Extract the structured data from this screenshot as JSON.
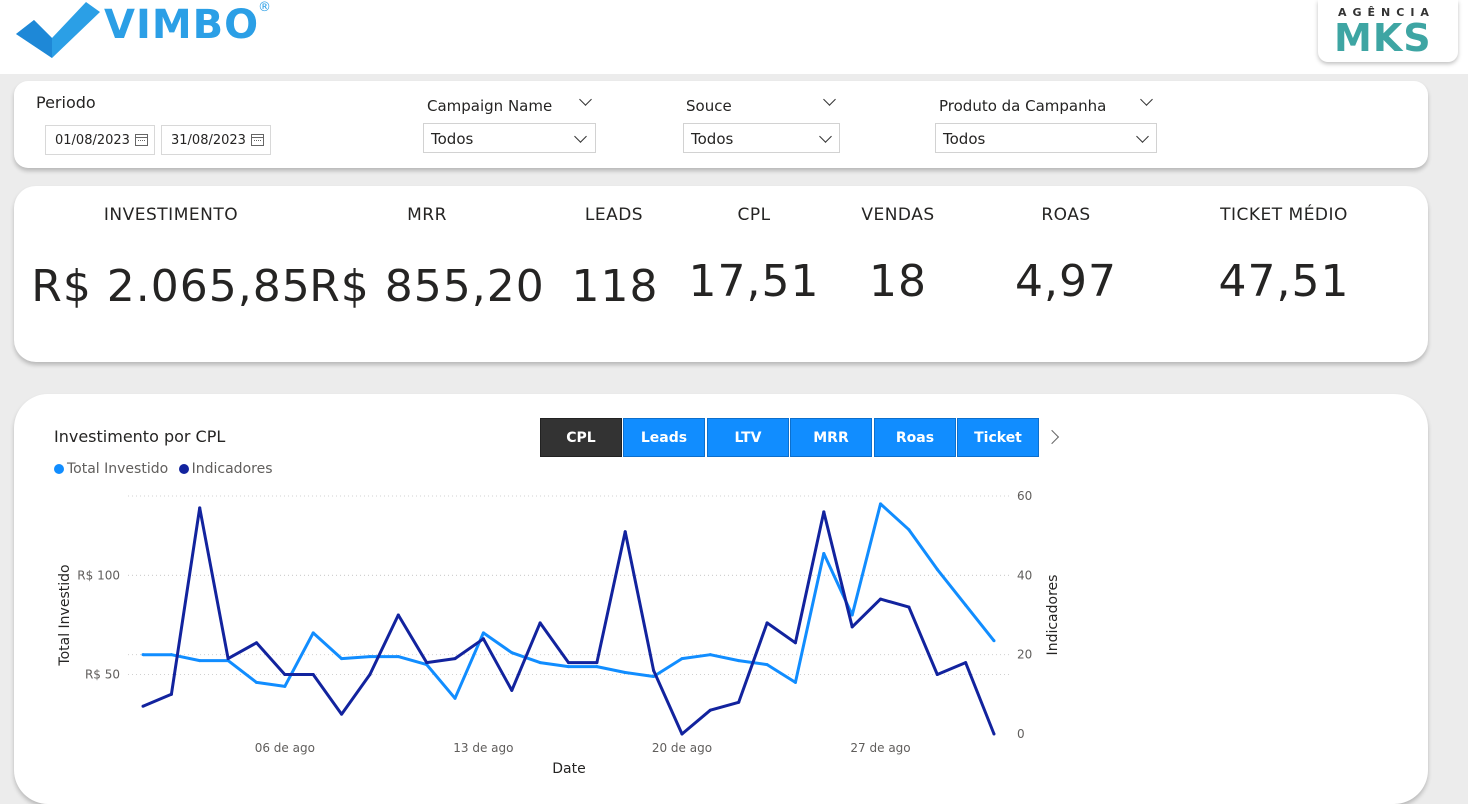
{
  "header": {
    "brand": "VIMBO",
    "brand_mark": "®",
    "agency_small": "AGÊNCIA",
    "agency_name": "MKS"
  },
  "filters": {
    "periodo": {
      "label": "Periodo",
      "start": "01/08/2023",
      "end": "31/08/2023"
    },
    "campaign": {
      "label": "Campaign Name",
      "value": "Todos"
    },
    "source": {
      "label": "Souce",
      "value": "Todos"
    },
    "produto": {
      "label": "Produto da Campanha",
      "value": "Todos"
    }
  },
  "kpis": [
    {
      "title": "INVESTIMENTO",
      "value": "R$ 2.065,85"
    },
    {
      "title": "MRR",
      "value": "R$ 855,20"
    },
    {
      "title": "LEADS",
      "value": "118"
    },
    {
      "title": "CPL",
      "value": "17,51"
    },
    {
      "title": "VENDAS",
      "value": "18"
    },
    {
      "title": "ROAS",
      "value": "4,97"
    },
    {
      "title": "TICKET MÉDIO",
      "value": "47,51"
    }
  ],
  "chart_panel": {
    "title": "Investimento por CPL",
    "buttons": [
      "CPL",
      "Leads",
      "LTV",
      "MRR",
      "Roas",
      "Ticket"
    ],
    "active_button": "CPL"
  },
  "colors": {
    "accent": "#118dff",
    "series_investido": "#118dff",
    "series_indicadores": "#12239e",
    "brand": "#2b9fe6",
    "agency": "#3ea5a3"
  },
  "chart_data": {
    "type": "line",
    "xlabel": "Date",
    "ylabel_left": "Total Investido",
    "ylabel_right": "Indicadores",
    "x": [
      "2023-08-01",
      "2023-08-02",
      "2023-08-03",
      "2023-08-04",
      "2023-08-05",
      "2023-08-06",
      "2023-08-07",
      "2023-08-08",
      "2023-08-09",
      "2023-08-10",
      "2023-08-11",
      "2023-08-12",
      "2023-08-13",
      "2023-08-14",
      "2023-08-15",
      "2023-08-16",
      "2023-08-17",
      "2023-08-18",
      "2023-08-19",
      "2023-08-20",
      "2023-08-21",
      "2023-08-22",
      "2023-08-23",
      "2023-08-24",
      "2023-08-25",
      "2023-08-26",
      "2023-08-27",
      "2023-08-28",
      "2023-08-29",
      "2023-08-30",
      "2023-08-31"
    ],
    "x_ticks": [
      "06 de ago",
      "13 de ago",
      "20 de ago",
      "27 de ago"
    ],
    "x_tick_dates": [
      "2023-08-06",
      "2023-08-13",
      "2023-08-20",
      "2023-08-27"
    ],
    "y_left_ticks": [
      "R$ 50",
      "R$ 100"
    ],
    "y_left_tick_values": [
      50,
      100
    ],
    "y_left_range": [
      20,
      140
    ],
    "y_right_ticks": [
      "0",
      "20",
      "40",
      "60"
    ],
    "y_right_tick_values": [
      0,
      20,
      40,
      60
    ],
    "y_right_range": [
      0,
      60
    ],
    "grid": "dotted horizontal",
    "legend_position": "top-left",
    "series": [
      {
        "name": "Total Investido",
        "axis": "left",
        "values": [
          60,
          60,
          57,
          57,
          46,
          44,
          71,
          58,
          59,
          59,
          55,
          38,
          71,
          61,
          56,
          54,
          54,
          51,
          49,
          58,
          60,
          57,
          55,
          46,
          111,
          80,
          136,
          123,
          103,
          85,
          67
        ]
      },
      {
        "name": "Indicadores",
        "axis": "right",
        "values": [
          7,
          10,
          57,
          19,
          23,
          15,
          15,
          5,
          15,
          30,
          18,
          19,
          24,
          11,
          28,
          18,
          18,
          51,
          16,
          0,
          6,
          8,
          28,
          23,
          56,
          27,
          34,
          32,
          15,
          18,
          0
        ]
      }
    ]
  }
}
